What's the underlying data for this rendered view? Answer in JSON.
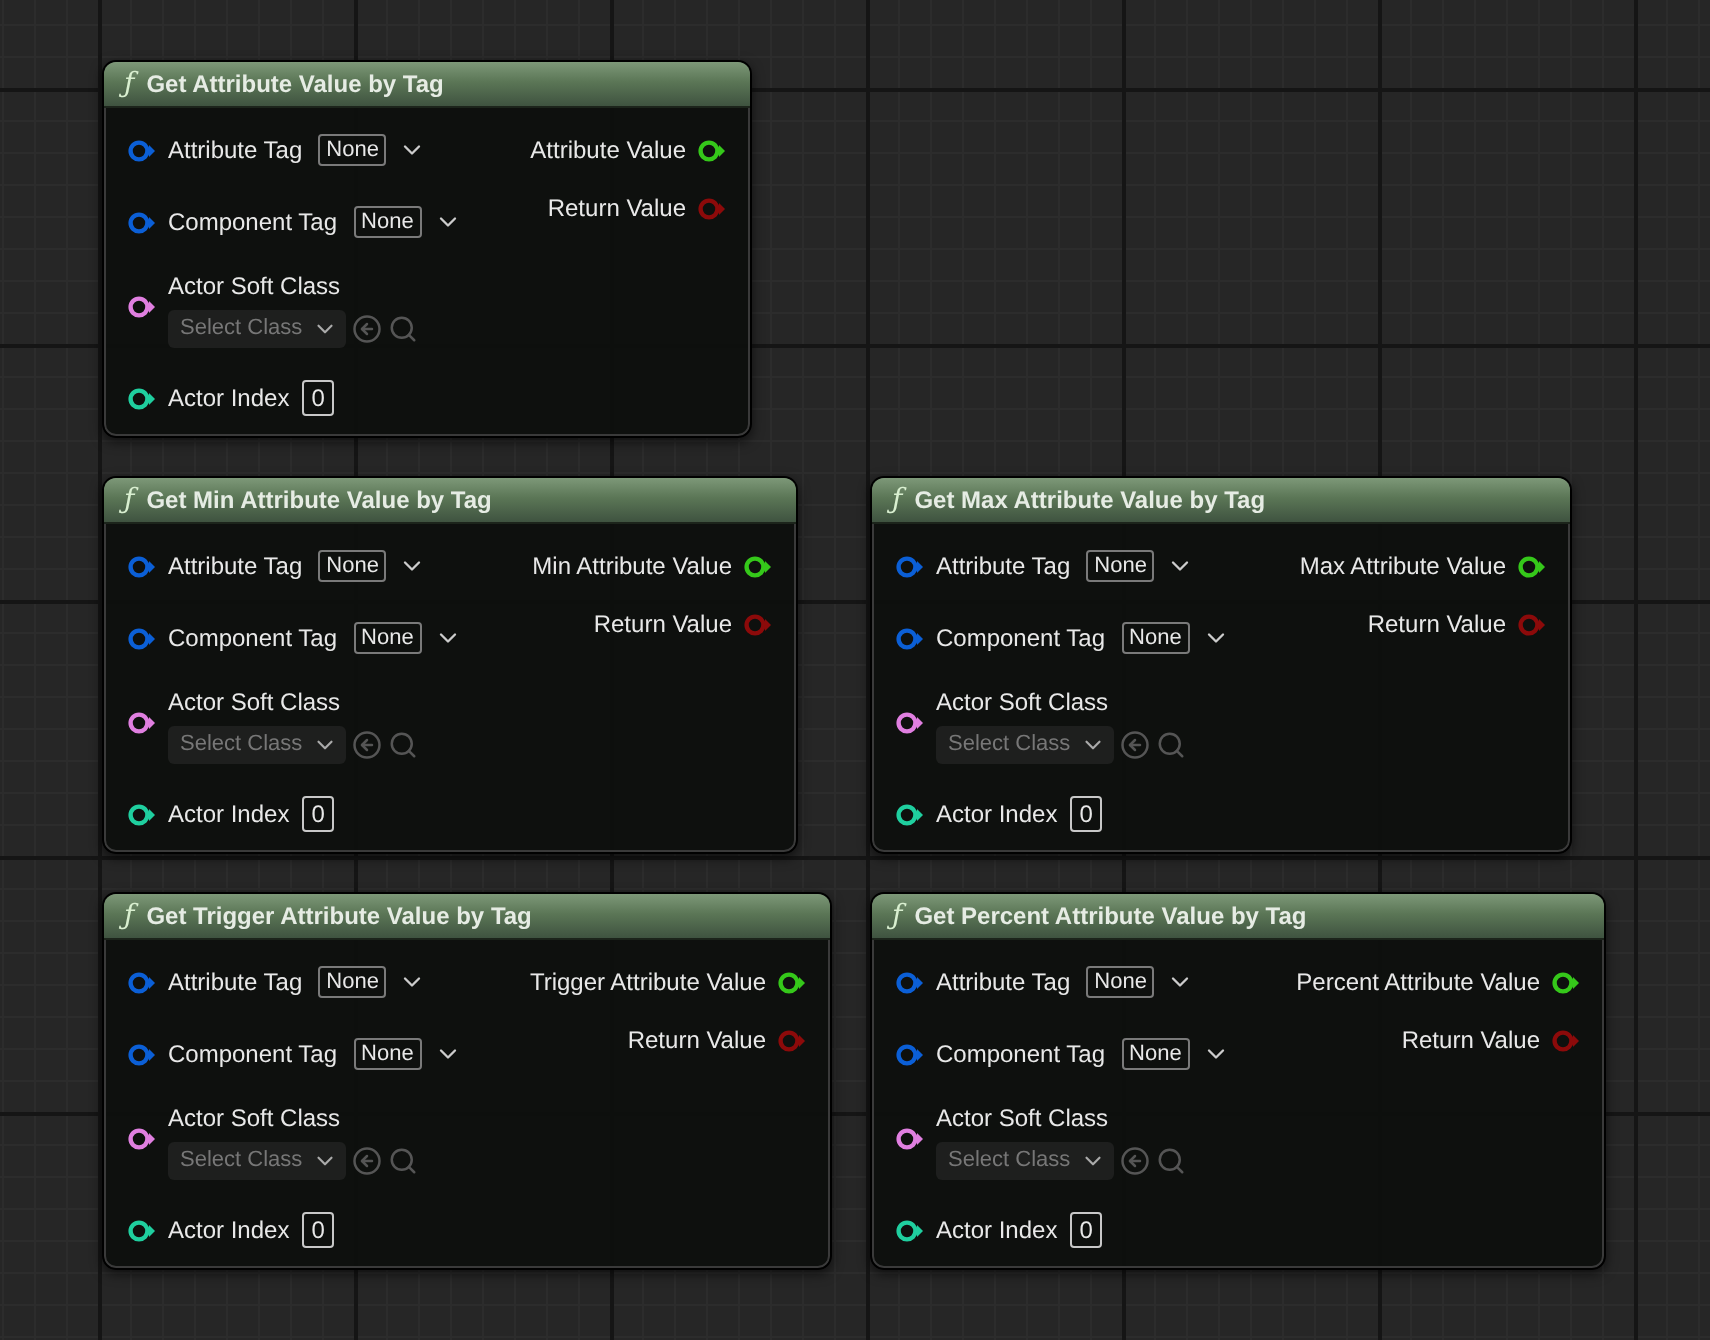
{
  "nodes": [
    {
      "glyph": "ƒ",
      "title": "Get Attribute Value by Tag",
      "inputs": [
        {
          "kind": "tag",
          "name": "Attribute Tag",
          "value": "None",
          "color": "#0b5fd6"
        },
        {
          "kind": "tag",
          "name": "Component Tag",
          "value": "None",
          "color": "#0b5fd6"
        },
        {
          "kind": "class",
          "name": "Actor Soft Class",
          "placeholder": "Select Class",
          "color": "#e07fe0"
        },
        {
          "kind": "int",
          "name": "Actor Index",
          "value": "0",
          "color": "#1fcf9f"
        }
      ],
      "outputs": [
        {
          "name": "Attribute Value",
          "color": "#35c81a"
        },
        {
          "name": "Return Value",
          "color": "#8c0a0a"
        }
      ]
    },
    {
      "glyph": "ƒ",
      "title": "Get Min Attribute Value by Tag",
      "inputs": [
        {
          "kind": "tag",
          "name": "Attribute Tag",
          "value": "None",
          "color": "#0b5fd6"
        },
        {
          "kind": "tag",
          "name": "Component Tag",
          "value": "None",
          "color": "#0b5fd6"
        },
        {
          "kind": "class",
          "name": "Actor Soft Class",
          "placeholder": "Select Class",
          "color": "#e07fe0"
        },
        {
          "kind": "int",
          "name": "Actor Index",
          "value": "0",
          "color": "#1fcf9f"
        }
      ],
      "outputs": [
        {
          "name": "Min Attribute Value",
          "color": "#35c81a"
        },
        {
          "name": "Return Value",
          "color": "#8c0a0a"
        }
      ]
    },
    {
      "glyph": "ƒ",
      "title": "Get Max Attribute Value by Tag",
      "inputs": [
        {
          "kind": "tag",
          "name": "Attribute Tag",
          "value": "None",
          "color": "#0b5fd6"
        },
        {
          "kind": "tag",
          "name": "Component Tag",
          "value": "None",
          "color": "#0b5fd6"
        },
        {
          "kind": "class",
          "name": "Actor Soft Class",
          "placeholder": "Select Class",
          "color": "#e07fe0"
        },
        {
          "kind": "int",
          "name": "Actor Index",
          "value": "0",
          "color": "#1fcf9f"
        }
      ],
      "outputs": [
        {
          "name": "Max Attribute Value",
          "color": "#35c81a"
        },
        {
          "name": "Return Value",
          "color": "#8c0a0a"
        }
      ]
    },
    {
      "glyph": "ƒ",
      "title": "Get Trigger Attribute Value by Tag",
      "inputs": [
        {
          "kind": "tag",
          "name": "Attribute Tag",
          "value": "None",
          "color": "#0b5fd6"
        },
        {
          "kind": "tag",
          "name": "Component Tag",
          "value": "None",
          "color": "#0b5fd6"
        },
        {
          "kind": "class",
          "name": "Actor Soft Class",
          "placeholder": "Select Class",
          "color": "#e07fe0"
        },
        {
          "kind": "int",
          "name": "Actor Index",
          "value": "0",
          "color": "#1fcf9f"
        }
      ],
      "outputs": [
        {
          "name": "Trigger Attribute Value",
          "color": "#35c81a"
        },
        {
          "name": "Return Value",
          "color": "#8c0a0a"
        }
      ]
    },
    {
      "glyph": "ƒ",
      "title": "Get Percent Attribute Value by Tag",
      "inputs": [
        {
          "kind": "tag",
          "name": "Attribute Tag",
          "value": "None",
          "color": "#0b5fd6"
        },
        {
          "kind": "tag",
          "name": "Component Tag",
          "value": "None",
          "color": "#0b5fd6"
        },
        {
          "kind": "class",
          "name": "Actor Soft Class",
          "placeholder": "Select Class",
          "color": "#e07fe0"
        },
        {
          "kind": "int",
          "name": "Actor Index",
          "value": "0",
          "color": "#1fcf9f"
        }
      ],
      "outputs": [
        {
          "name": "Percent Attribute Value",
          "color": "#35c81a"
        },
        {
          "name": "Return Value",
          "color": "#8c0a0a"
        }
      ]
    }
  ]
}
